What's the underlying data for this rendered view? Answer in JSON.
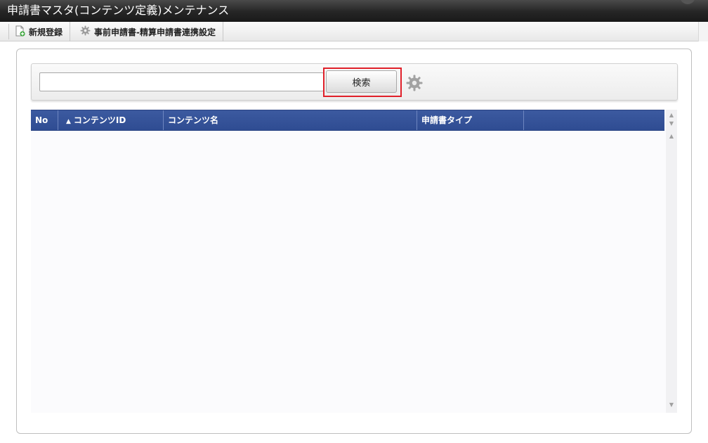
{
  "window": {
    "title": "申請書マスタ(コンテンツ定義)メンテナンス"
  },
  "toolbar": {
    "new_label": "新規登録",
    "link_settings_label": "事前申請書-精算申請書連携設定"
  },
  "search": {
    "input_value": "",
    "placeholder": "",
    "button_label": "検索"
  },
  "grid": {
    "columns": [
      {
        "label": "No"
      },
      {
        "label": "コンテンツID",
        "sort": "asc"
      },
      {
        "label": "コンテンツ名"
      },
      {
        "label": "申請書タイプ"
      },
      {
        "label": ""
      }
    ],
    "rows": []
  },
  "colors": {
    "header_blue": "#2f4c92",
    "title_bar": "#262626",
    "highlight_red": "#e0202a"
  },
  "icons": {
    "new": "new-document-plus-icon",
    "link_settings": "gear-icon",
    "search_settings": "gear-icon",
    "sort": "sort-ascending-icon"
  }
}
